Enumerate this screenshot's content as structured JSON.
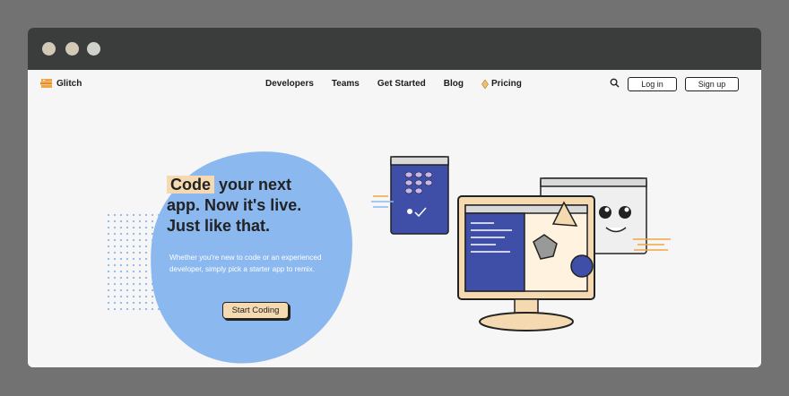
{
  "brand": {
    "name": "Glitch"
  },
  "nav": {
    "links": [
      "Developers",
      "Teams",
      "Get Started",
      "Blog",
      "Pricing"
    ],
    "login": "Log in",
    "signup": "Sign up"
  },
  "hero": {
    "headline_highlight": "Code",
    "headline_rest_1": "your next",
    "headline_line_2": "app. Now it's live.",
    "headline_line_3": "Just like that.",
    "subtext": "Whether you're new to code or an experienced developer, simply pick a starter app to remix.",
    "cta": "Start Coding"
  },
  "colors": {
    "frame": "#727272",
    "titlebar": "#3b3d3c",
    "blob": "#8ab8ef",
    "highlight": "#f5d9b1",
    "accent_blue": "#3f4fa8"
  }
}
